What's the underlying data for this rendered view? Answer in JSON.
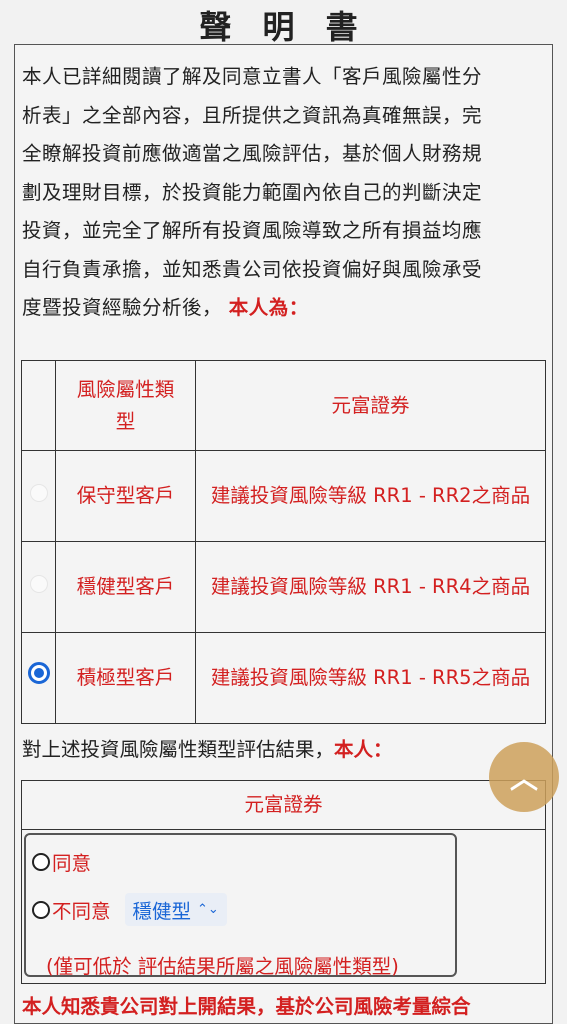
{
  "title": "聲 明 書",
  "declaration": {
    "lines": [
      "本人已詳細閱讀了解及同意立書人「客戶風險屬性分",
      "析表」之全部內容，且所提供之資訊為真確無誤，完",
      "全瞭解投資前應做適當之風險評估，基於個人財務規",
      "劃及理財目標，於投資能力範圍內依自己的判斷決定",
      "投資，並完全了解所有投資風險導致之所有損益均應",
      "自行負責承擔，並知悉貴公司依投資偏好與風險承受",
      "度暨投資經驗分析後，"
    ],
    "emphasis": "本人為："
  },
  "risk_table": {
    "header_type": "風險屬性類型",
    "header_company": "元富證券",
    "rows": [
      {
        "type": "保守型客戶",
        "suggestion": "建議投資風險等級 RR1 - RR2之商品",
        "selected": false
      },
      {
        "type": "穩健型客戶",
        "suggestion": "建議投資風險等級 RR1 - RR4之商品",
        "selected": false
      },
      {
        "type": "積極型客戶",
        "suggestion": "建議投資風險等級 RR1 - RR5之商品",
        "selected": true
      }
    ]
  },
  "evaluation": {
    "prefix": "對上述投資風險屬性類型評估結果，",
    "emphasis": "本人："
  },
  "agreement": {
    "company": "元富證券",
    "agree_label": "同意",
    "disagree_label": "不同意",
    "select_value": "穩健型",
    "note": "(僅可低於 評估結果所屬之風險屬性類型)"
  },
  "footer_text": "本人知悉貴公司對上開結果，基於公司風險考量綜合",
  "scroll_top_icon": "chevron-up-icon",
  "colors": {
    "accent_red": "#d32020",
    "radio_blue": "#1a66d6",
    "fab": "#cda05a"
  }
}
